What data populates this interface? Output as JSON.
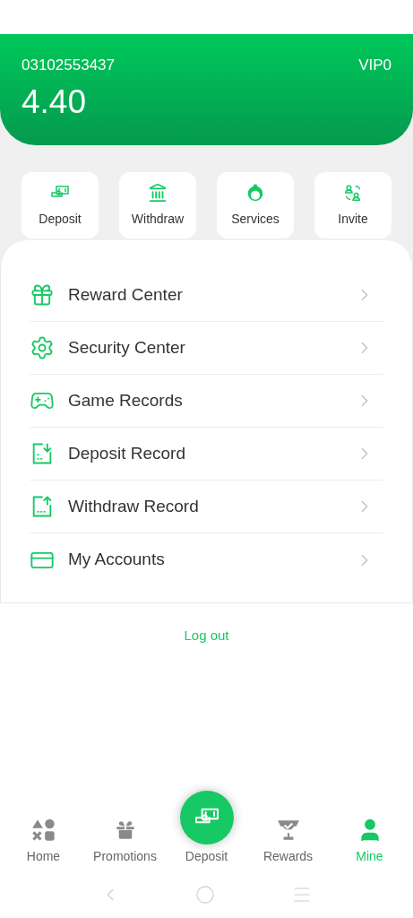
{
  "account": {
    "phone": "03102553437",
    "vip": "VIP0",
    "balance": "4.40"
  },
  "quick_actions": [
    {
      "label": "Deposit"
    },
    {
      "label": "Withdraw"
    },
    {
      "label": "Services"
    },
    {
      "label": "Invite"
    }
  ],
  "menu": [
    {
      "label": "Reward Center"
    },
    {
      "label": "Security Center"
    },
    {
      "label": "Game Records"
    },
    {
      "label": "Deposit Record"
    },
    {
      "label": "Withdraw Record"
    },
    {
      "label": "My Accounts"
    }
  ],
  "logout": "Log out",
  "bottom_nav": [
    {
      "label": "Home",
      "selected": false
    },
    {
      "label": "Promotions",
      "selected": false
    },
    {
      "label": "Deposit",
      "selected": false,
      "kind": "fab"
    },
    {
      "label": "Rewards",
      "selected": false
    },
    {
      "label": "Mine",
      "selected": true
    }
  ]
}
